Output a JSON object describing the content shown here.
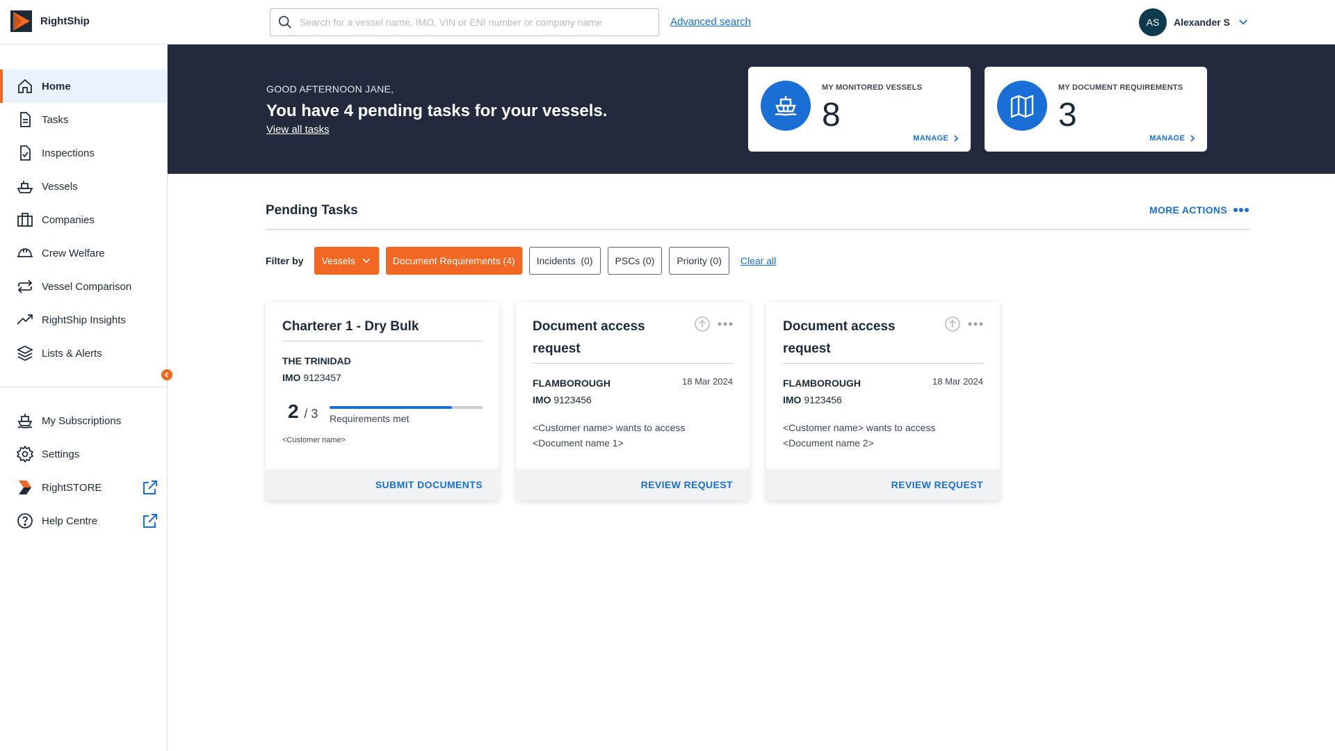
{
  "brand": {
    "name": "RightShip",
    "color": "#f26722",
    "accent": "#1a6fd6",
    "dark": "#232a3e"
  },
  "search": {
    "placeholder": "Search for a vessel name, IMO, VIN or ENI number or company name",
    "advanced_label": "Advanced search"
  },
  "user": {
    "initials": "AS",
    "name": "Alexander S"
  },
  "sidebar": {
    "items": [
      {
        "label": "Home",
        "icon": "home-icon",
        "active": true
      },
      {
        "label": "Tasks",
        "icon": "tasks-icon"
      },
      {
        "label": "Inspections",
        "icon": "inspections-icon"
      },
      {
        "label": "Vessels",
        "icon": "vessel-icon"
      },
      {
        "label": "Companies",
        "icon": "companies-icon"
      },
      {
        "label": "Crew Welfare",
        "icon": "crew-helmet-icon"
      },
      {
        "label": "Vessel Comparison",
        "icon": "compare-icon"
      },
      {
        "label": "RightShip Insights",
        "icon": "trend-icon"
      },
      {
        "label": "Lists & Alerts",
        "icon": "layers-icon"
      }
    ],
    "bottom_items": [
      {
        "label": "My Subscriptions",
        "icon": "subscription-ship-icon"
      },
      {
        "label": "Settings",
        "icon": "gear-icon"
      },
      {
        "label": "RightSTORE",
        "icon": "rightstore-logo-icon",
        "external": true
      },
      {
        "label": "Help Centre",
        "icon": "help-icon",
        "external": true
      }
    ]
  },
  "hero": {
    "greeting": "GOOD AFTERNOON JANE,",
    "headline": "You have 4 pending tasks for your vessels.",
    "link": "View all tasks",
    "cards": [
      {
        "label": "MY MONITORED VESSELS",
        "value": "8",
        "action": "MANAGE",
        "icon": "ship-icon"
      },
      {
        "label": "MY DOCUMENT REQUIREMENTS",
        "value": "3",
        "action": "MANAGE",
        "icon": "map-icon"
      }
    ]
  },
  "pending": {
    "title": "Pending Tasks",
    "more_actions": "MORE ACTIONS",
    "filter_label": "Filter by",
    "filters": [
      {
        "label": "Vessels",
        "style": "orange",
        "dropdown": true
      },
      {
        "label": "Document Requirements (4)",
        "style": "orange"
      },
      {
        "label": "Incidents  (0)",
        "style": "outline"
      },
      {
        "label": "PSCs (0)",
        "style": "outline"
      },
      {
        "label": "Priority (0)",
        "style": "outline"
      }
    ],
    "clear_all": "Clear all",
    "cards": [
      {
        "title": "Charterer 1 - Dry Bulk",
        "vessel": "THE TRINIDAD",
        "imo_label": "IMO",
        "imo": "9123457",
        "count": "2",
        "total": "/ 3",
        "progress": 0.8,
        "progress_label": "Requirements met",
        "customer": "<Customer name>",
        "action": "SUBMIT DOCUMENTS"
      },
      {
        "title": "Document access request",
        "vessel": "FLAMBOROUGH",
        "imo_label": "IMO",
        "imo": "9123456",
        "date": "18 Mar 2024",
        "message": "<Customer name> wants to access <Document name 1>",
        "action": "REVIEW REQUEST"
      },
      {
        "title": "Document access request",
        "vessel": "FLAMBOROUGH",
        "imo_label": "IMO",
        "imo": "9123456",
        "date": "18 Mar 2024",
        "message": "<Customer name> wants to access <Document name 2>",
        "action": "REVIEW REQUEST"
      }
    ]
  }
}
